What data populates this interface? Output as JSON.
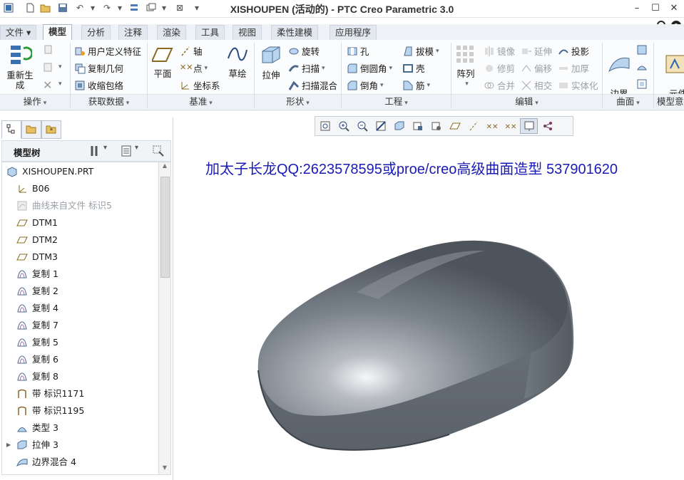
{
  "window": {
    "title": "XISHOUPEN (活动的) - PTC Creo Parametric 3.0",
    "controls": [
      "–",
      "☐",
      "✕"
    ],
    "help_icons": [
      "chevron-up-icon",
      "search-icon",
      "help-icon"
    ]
  },
  "tabs": [
    {
      "label": "文件 ▾",
      "active": false
    },
    {
      "label": "模型",
      "active": true
    },
    {
      "label": "分析",
      "active": false
    },
    {
      "label": "注释",
      "active": false
    },
    {
      "label": "渲染",
      "active": false
    },
    {
      "label": "工具",
      "active": false
    },
    {
      "label": "视图",
      "active": false
    },
    {
      "label": "柔性建模",
      "active": false
    },
    {
      "label": "应用程序",
      "active": false
    }
  ],
  "ribbon": {
    "ops": {
      "regen": "重新生成",
      "group": "操作"
    },
    "getdata": {
      "udf": "用户定义特征",
      "copygeom": "复制几何",
      "shrink": "收缩包络",
      "group": "获取数据"
    },
    "datum": {
      "plane": "平面",
      "axis": "轴",
      "point": "点",
      "csys": "坐标系",
      "sketch": "草绘",
      "group": "基准"
    },
    "shape": {
      "extrude": "拉伸",
      "revolve": "旋转",
      "sweep": "扫描",
      "sweptblend": "扫描混合",
      "group": "形状"
    },
    "eng": {
      "hole": "孔",
      "round": "倒圆角",
      "chamfer": "倒角",
      "draft": "拔模",
      "shell": "壳",
      "rib": "筋",
      "group": "工程"
    },
    "edit": {
      "pattern": "阵列",
      "mirror": "镜像",
      "trim": "修剪",
      "merge": "合并",
      "extend": "延伸",
      "offset": "偏移",
      "intersect": "相交",
      "project": "投影",
      "thicken": "加厚",
      "solidify": "实体化",
      "group": "编辑"
    },
    "surface": {
      "boundary": "边界\n混合",
      "group": "曲面"
    },
    "model_intent": {
      "label": "元件\n界面",
      "group": "模型意图"
    }
  },
  "panel": {
    "tree_label": "模型树",
    "items": [
      {
        "label": "XISHOUPEN.PRT",
        "icon": "part-icon",
        "indent": 0,
        "dim": false
      },
      {
        "label": "B06",
        "icon": "csys-icon",
        "indent": 1,
        "dim": false
      },
      {
        "label": "曲线来自文件 标识5",
        "icon": "curve-file-icon",
        "indent": 1,
        "dim": true
      },
      {
        "label": "DTM1",
        "icon": "datum-plane-icon",
        "indent": 1,
        "dim": false
      },
      {
        "label": "DTM2",
        "icon": "datum-plane-icon",
        "indent": 1,
        "dim": false
      },
      {
        "label": "DTM3",
        "icon": "datum-plane-icon",
        "indent": 1,
        "dim": false
      },
      {
        "label": "复制 1",
        "icon": "copy-icon",
        "indent": 1,
        "dim": false
      },
      {
        "label": "复制 2",
        "icon": "copy-icon",
        "indent": 1,
        "dim": false
      },
      {
        "label": "复制 4",
        "icon": "copy-icon",
        "indent": 1,
        "dim": false
      },
      {
        "label": "复制 7",
        "icon": "copy-icon",
        "indent": 1,
        "dim": false
      },
      {
        "label": "复制 5",
        "icon": "copy-icon",
        "indent": 1,
        "dim": false
      },
      {
        "label": "复制 6",
        "icon": "copy-icon",
        "indent": 1,
        "dim": false
      },
      {
        "label": "复制 8",
        "icon": "copy-icon",
        "indent": 1,
        "dim": false
      },
      {
        "label": "带 标识1171",
        "icon": "band-icon",
        "indent": 1,
        "dim": false
      },
      {
        "label": "带 标识1195",
        "icon": "band-icon",
        "indent": 1,
        "dim": false
      },
      {
        "label": "类型 3",
        "icon": "surface-type-icon",
        "indent": 1,
        "dim": false
      },
      {
        "label": "拉伸 3",
        "icon": "extrude-icon",
        "indent": 1,
        "dim": false,
        "expandable": true
      },
      {
        "label": "边界混合 4",
        "icon": "boundary-blend-icon",
        "indent": 1,
        "dim": false
      }
    ]
  },
  "graphics": {
    "banner": "加太子长龙QQ:2623578595或proe/creo高级曲面造型 537901620",
    "toolbar_icons": [
      "refit-icon",
      "zoom-in-icon",
      "zoom-out-icon",
      "repaint-icon",
      "display-style-icon",
      "saved-views-icon",
      "view-manager-icon",
      "plane-display-icon",
      "axis-display-icon",
      "point-display-icon",
      "csys-display-icon",
      "annotation-display-icon",
      "spin-center-icon"
    ],
    "toolbar_active_index": 11,
    "model_color": "#6f7780"
  },
  "colors": {
    "accent": "#1a1ab4",
    "tab_bg": "#e3e8ee"
  }
}
